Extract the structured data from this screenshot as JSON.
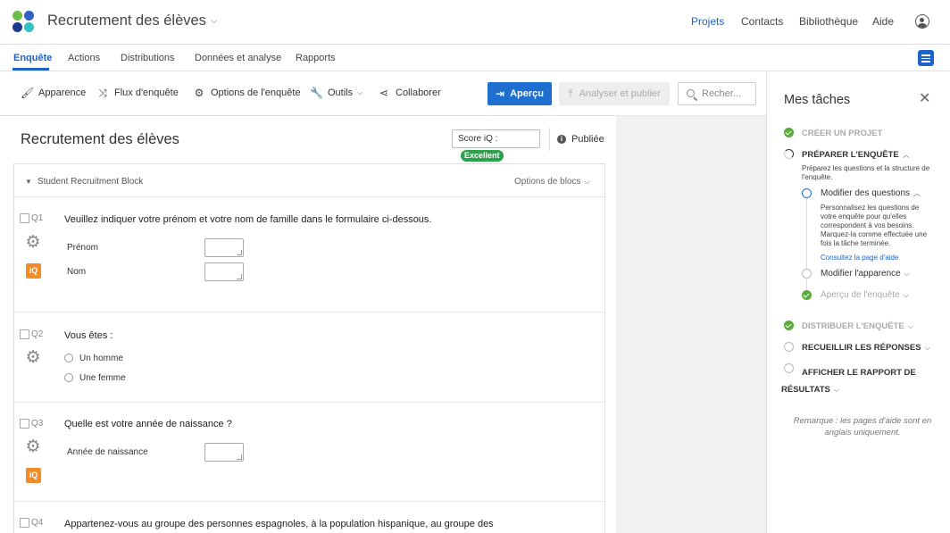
{
  "header": {
    "title": "Recrutement des élèves",
    "nav": [
      "Projets",
      "Contacts",
      "Bibliothèque",
      "Aide"
    ],
    "active_nav": "Projets"
  },
  "tabs": [
    "Enquête",
    "Actions",
    "Distributions",
    "Données et analyse",
    "Rapports"
  ],
  "toolbar": {
    "items": [
      "Apparence",
      "Flux d'enquête",
      "Options de l'enquête",
      "Outils",
      "Collaborer"
    ],
    "preview": "Aperçu",
    "publish": "Analyser et publier",
    "search_placeholder": "Recher..."
  },
  "survey": {
    "title": "Recrutement des élèves",
    "score_label": "Score iQ :",
    "score_value": "Excellent",
    "status": "Publiée"
  },
  "block": {
    "name": "Student Recruitment Block",
    "options": "Options de blocs"
  },
  "questions": [
    {
      "id": "Q1",
      "text": "Veuillez indiquer votre prénom et votre nom de famille dans le formulaire ci-dessous.",
      "fields": [
        "Prénom",
        "Nom"
      ]
    },
    {
      "id": "Q2",
      "text": "Vous êtes :",
      "options": [
        "Un homme",
        "Une femme"
      ]
    },
    {
      "id": "Q3",
      "text": "Quelle est votre année de naissance ?",
      "fields": [
        "Année de naissance"
      ]
    },
    {
      "id": "Q4",
      "text": "Appartenez-vous au groupe des personnes espagnoles, à la population hispanique, au groupe des"
    }
  ],
  "tasks": {
    "title": "Mes tâches",
    "create": "CRÉER UN PROJET",
    "prepare": "PRÉPARER L'ENQUÊTE",
    "prepare_desc": "Préparez les questions et la structure de l'enquête.",
    "edit_questions": "Modifier des questions",
    "edit_questions_desc": "Personnalisez les questions de votre enquête pour qu'elles correspondent à vos besoins. Marquez-la comme effectuée une fois la tâche terminée.",
    "help_link": "Consultez la page d'aide",
    "edit_appearance": "Modifier l'apparence",
    "preview_survey": "Aperçu de l'enquête",
    "distribute": "DISTRIBUER L'ENQUÊTE",
    "collect": "RECUEILLIR LES RÉPONSES",
    "report": "AFFICHER LE RAPPORT DE RÉSULTATS",
    "note": "Remarque : les pages d'aide sont en anglais uniquement."
  }
}
